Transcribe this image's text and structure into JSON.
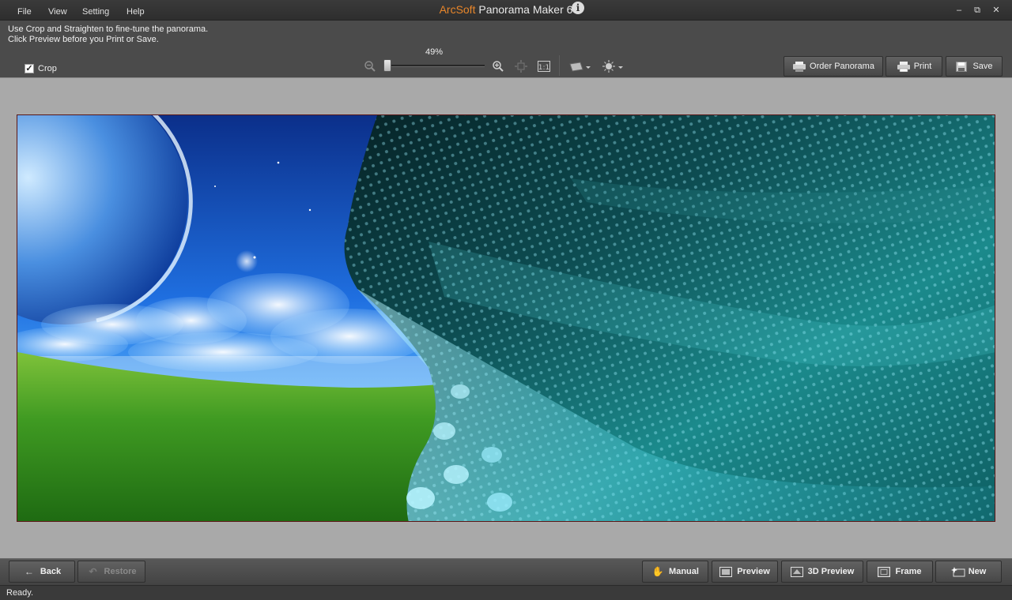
{
  "window": {
    "title_brand": "ArcSoft",
    "title_name": "Panorama Maker 6",
    "info_icon": "info-icon",
    "controls": {
      "minimize": "–",
      "restore": "⧉",
      "close": "✕"
    }
  },
  "menu": [
    {
      "label": "File"
    },
    {
      "label": "View"
    },
    {
      "label": "Setting"
    },
    {
      "label": "Help"
    }
  ],
  "hint": {
    "line1": "Use Crop and Straighten to fine-tune the panorama.",
    "line2": "Click Preview before you Print or Save."
  },
  "crop": {
    "label": "Crop",
    "checked": true
  },
  "zoom": {
    "label": "49%",
    "percent": 49
  },
  "toolbar_buttons": {
    "order": "Order Panorama",
    "print": "Print",
    "save": "Save"
  },
  "bottom_buttons": {
    "back": "Back",
    "restore": "Restore",
    "manual": "Manual",
    "preview": "Preview",
    "preview3d": "3D Preview",
    "frame": "Frame",
    "new": "New"
  },
  "status": {
    "text": "Ready."
  },
  "colors": {
    "brand": "#e8862a",
    "canvas_bg": "#a9a9a9",
    "toolbar_bg": "#4b4b4b"
  }
}
